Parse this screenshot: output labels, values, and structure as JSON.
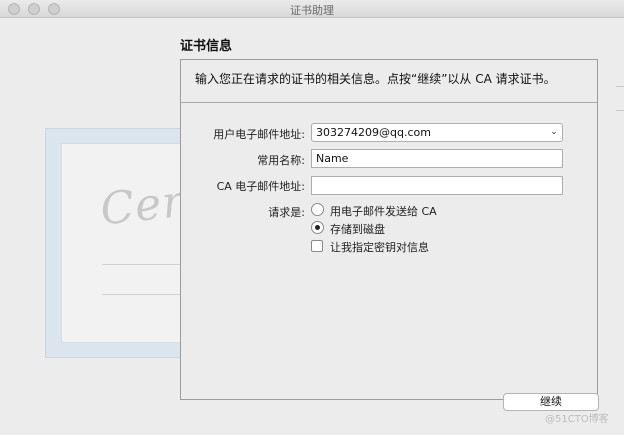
{
  "window": {
    "title": "证书助理"
  },
  "section": {
    "title": "证书信息"
  },
  "panel": {
    "intro": "输入您正在请求的证书的相关信息。点按“继续”以从 CA 请求证书。"
  },
  "form": {
    "user_email_label": "用户电子邮件地址:",
    "user_email_value": "303274209@qq.com",
    "common_name_label": "常用名称:",
    "common_name_value": "Name",
    "ca_email_label": "CA 电子邮件地址:",
    "ca_email_value": "",
    "request_label": "请求是:",
    "options": [
      {
        "label": "用电子邮件发送给 CA",
        "checked": false
      },
      {
        "label": "存储到磁盘",
        "checked": true
      }
    ],
    "specify_key_pair_label": "让我指定密钥对信息",
    "specify_key_pair_checked": false
  },
  "footer": {
    "continue_label": "继续",
    "watermark": "@51CTO博客"
  },
  "illustration": {
    "script_text": "Certificate"
  }
}
